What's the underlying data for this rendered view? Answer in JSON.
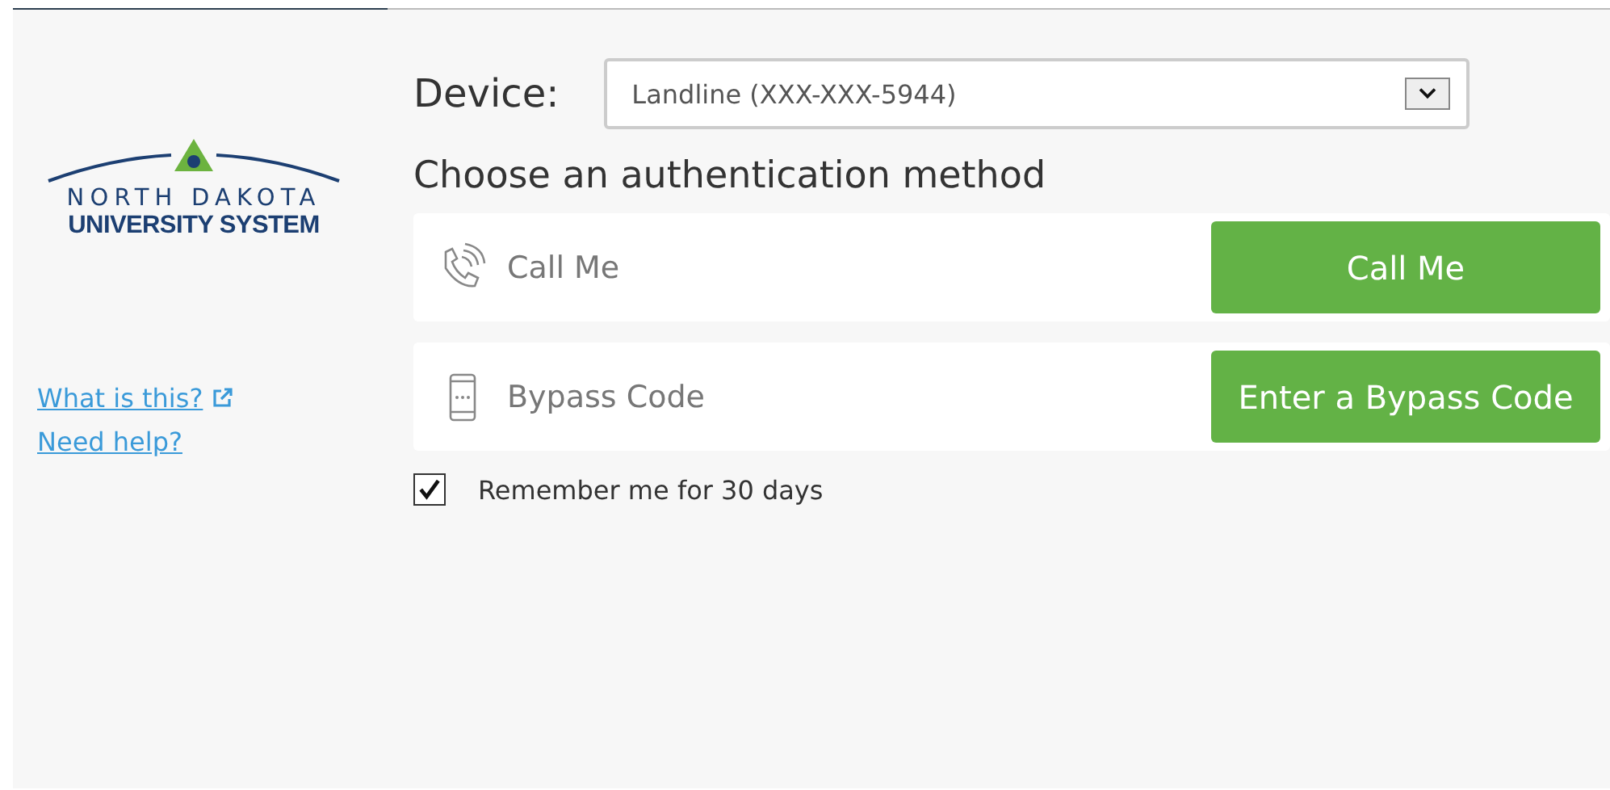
{
  "logo": {
    "line1": "NORTH DAKOTA",
    "line2": "UNIVERSITY SYSTEM"
  },
  "links": [
    {
      "label": "What is this?",
      "external": true
    },
    {
      "label": "Need help?",
      "external": false
    }
  ],
  "device": {
    "label": "Device:",
    "value": "Landline (XXX-XXX-5944)"
  },
  "heading": "Choose an authentication method",
  "methods": [
    {
      "kind": "phone",
      "label": "Call Me",
      "button": "Call Me"
    },
    {
      "kind": "passcode",
      "label": "Bypass Code",
      "button": "Enter a Bypass Code"
    }
  ],
  "remember": {
    "label": "Remember me for 30 days",
    "checked": true
  }
}
